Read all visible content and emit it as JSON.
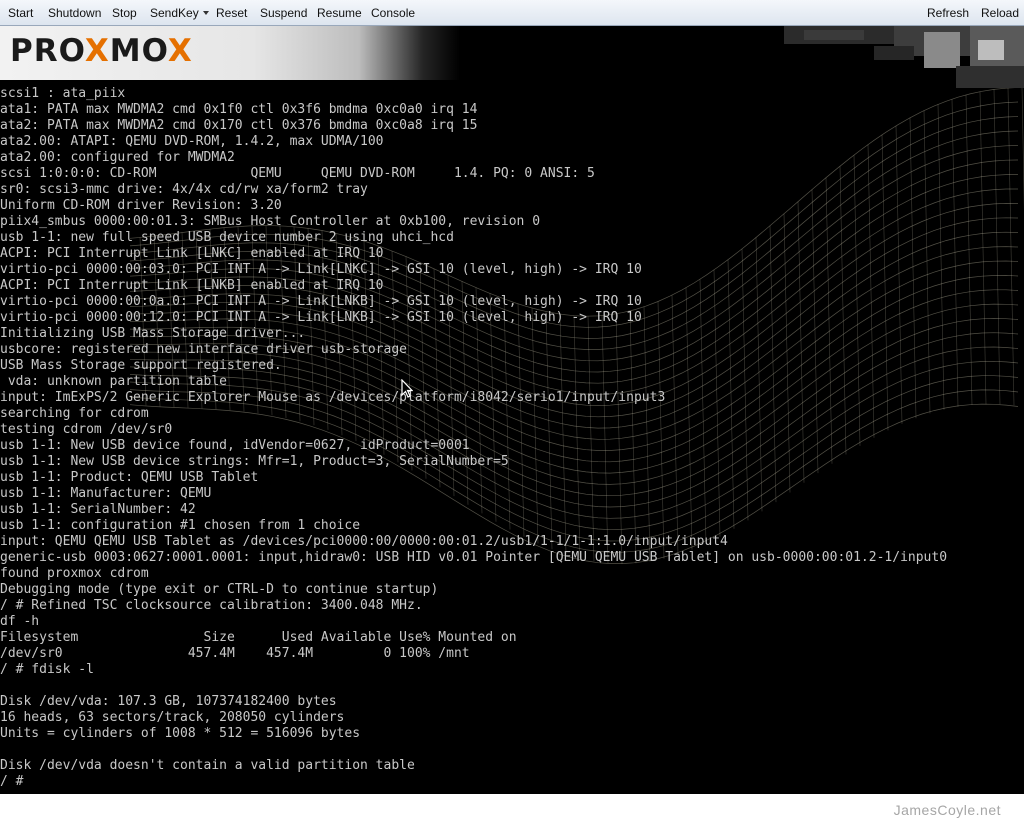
{
  "toolbar": {
    "start": "Start",
    "shutdown": "Shutdown",
    "stop": "Stop",
    "sendkey": "SendKey",
    "reset": "Reset",
    "suspend": "Suspend",
    "resume": "Resume",
    "console": "Console",
    "refresh": "Refresh",
    "reload": "Reload"
  },
  "logo": {
    "part1": "PRO",
    "part2": "X",
    "part3": "MO",
    "part4": "X",
    "accent_color": "#e57000"
  },
  "terminal": {
    "text_color": "#c8c8c8",
    "lines": [
      "scsi1 : ata_piix",
      "ata1: PATA max MWDMA2 cmd 0x1f0 ctl 0x3f6 bmdma 0xc0a0 irq 14",
      "ata2: PATA max MWDMA2 cmd 0x170 ctl 0x376 bmdma 0xc0a8 irq 15",
      "ata2.00: ATAPI: QEMU DVD-ROM, 1.4.2, max UDMA/100",
      "ata2.00: configured for MWDMA2",
      "scsi 1:0:0:0: CD-ROM            QEMU     QEMU DVD-ROM     1.4. PQ: 0 ANSI: 5",
      "sr0: scsi3-mmc drive: 4x/4x cd/rw xa/form2 tray",
      "Uniform CD-ROM driver Revision: 3.20",
      "piix4_smbus 0000:00:01.3: SMBus Host Controller at 0xb100, revision 0",
      "usb 1-1: new full speed USB device number 2 using uhci_hcd",
      "ACPI: PCI Interrupt Link [LNKC] enabled at IRQ 10",
      "virtio-pci 0000:00:03.0: PCI INT A -> Link[LNKC] -> GSI 10 (level, high) -> IRQ 10",
      "ACPI: PCI Interrupt Link [LNKB] enabled at IRQ 10",
      "virtio-pci 0000:00:0a.0: PCI INT A -> Link[LNKB] -> GSI 10 (level, high) -> IRQ 10",
      "virtio-pci 0000:00:12.0: PCI INT A -> Link[LNKB] -> GSI 10 (level, high) -> IRQ 10",
      "Initializing USB Mass Storage driver...",
      "usbcore: registered new interface driver usb-storage",
      "USB Mass Storage support registered.",
      " vda: unknown partition table",
      "input: ImExPS/2 Generic Explorer Mouse as /devices/platform/i8042/serio1/input/input3",
      "searching for cdrom",
      "testing cdrom /dev/sr0",
      "usb 1-1: New USB device found, idVendor=0627, idProduct=0001",
      "usb 1-1: New USB device strings: Mfr=1, Product=3, SerialNumber=5",
      "usb 1-1: Product: QEMU USB Tablet",
      "usb 1-1: Manufacturer: QEMU",
      "usb 1-1: SerialNumber: 42",
      "usb 1-1: configuration #1 chosen from 1 choice",
      "input: QEMU QEMU USB Tablet as /devices/pci0000:00/0000:00:01.2/usb1/1-1/1-1:1.0/input/input4",
      "generic-usb 0003:0627:0001.0001: input,hidraw0: USB HID v0.01 Pointer [QEMU QEMU USB Tablet] on usb-0000:00:01.2-1/input0",
      "found proxmox cdrom",
      "Debugging mode (type exit or CTRL-D to continue startup)",
      "/ # Refined TSC clocksource calibration: 3400.048 MHz.",
      "df -h",
      "Filesystem                Size      Used Available Use% Mounted on",
      "/dev/sr0                457.4M    457.4M         0 100% /mnt",
      "/ # fdisk -l",
      "",
      "Disk /dev/vda: 107.3 GB, 107374182400 bytes",
      "16 heads, 63 sectors/track, 208050 cylinders",
      "Units = cylinders of 1008 * 512 = 516096 bytes",
      "",
      "Disk /dev/vda doesn't contain a valid partition table",
      "/ #"
    ]
  },
  "footer": {
    "watermark": "JamesCoyle.net"
  }
}
